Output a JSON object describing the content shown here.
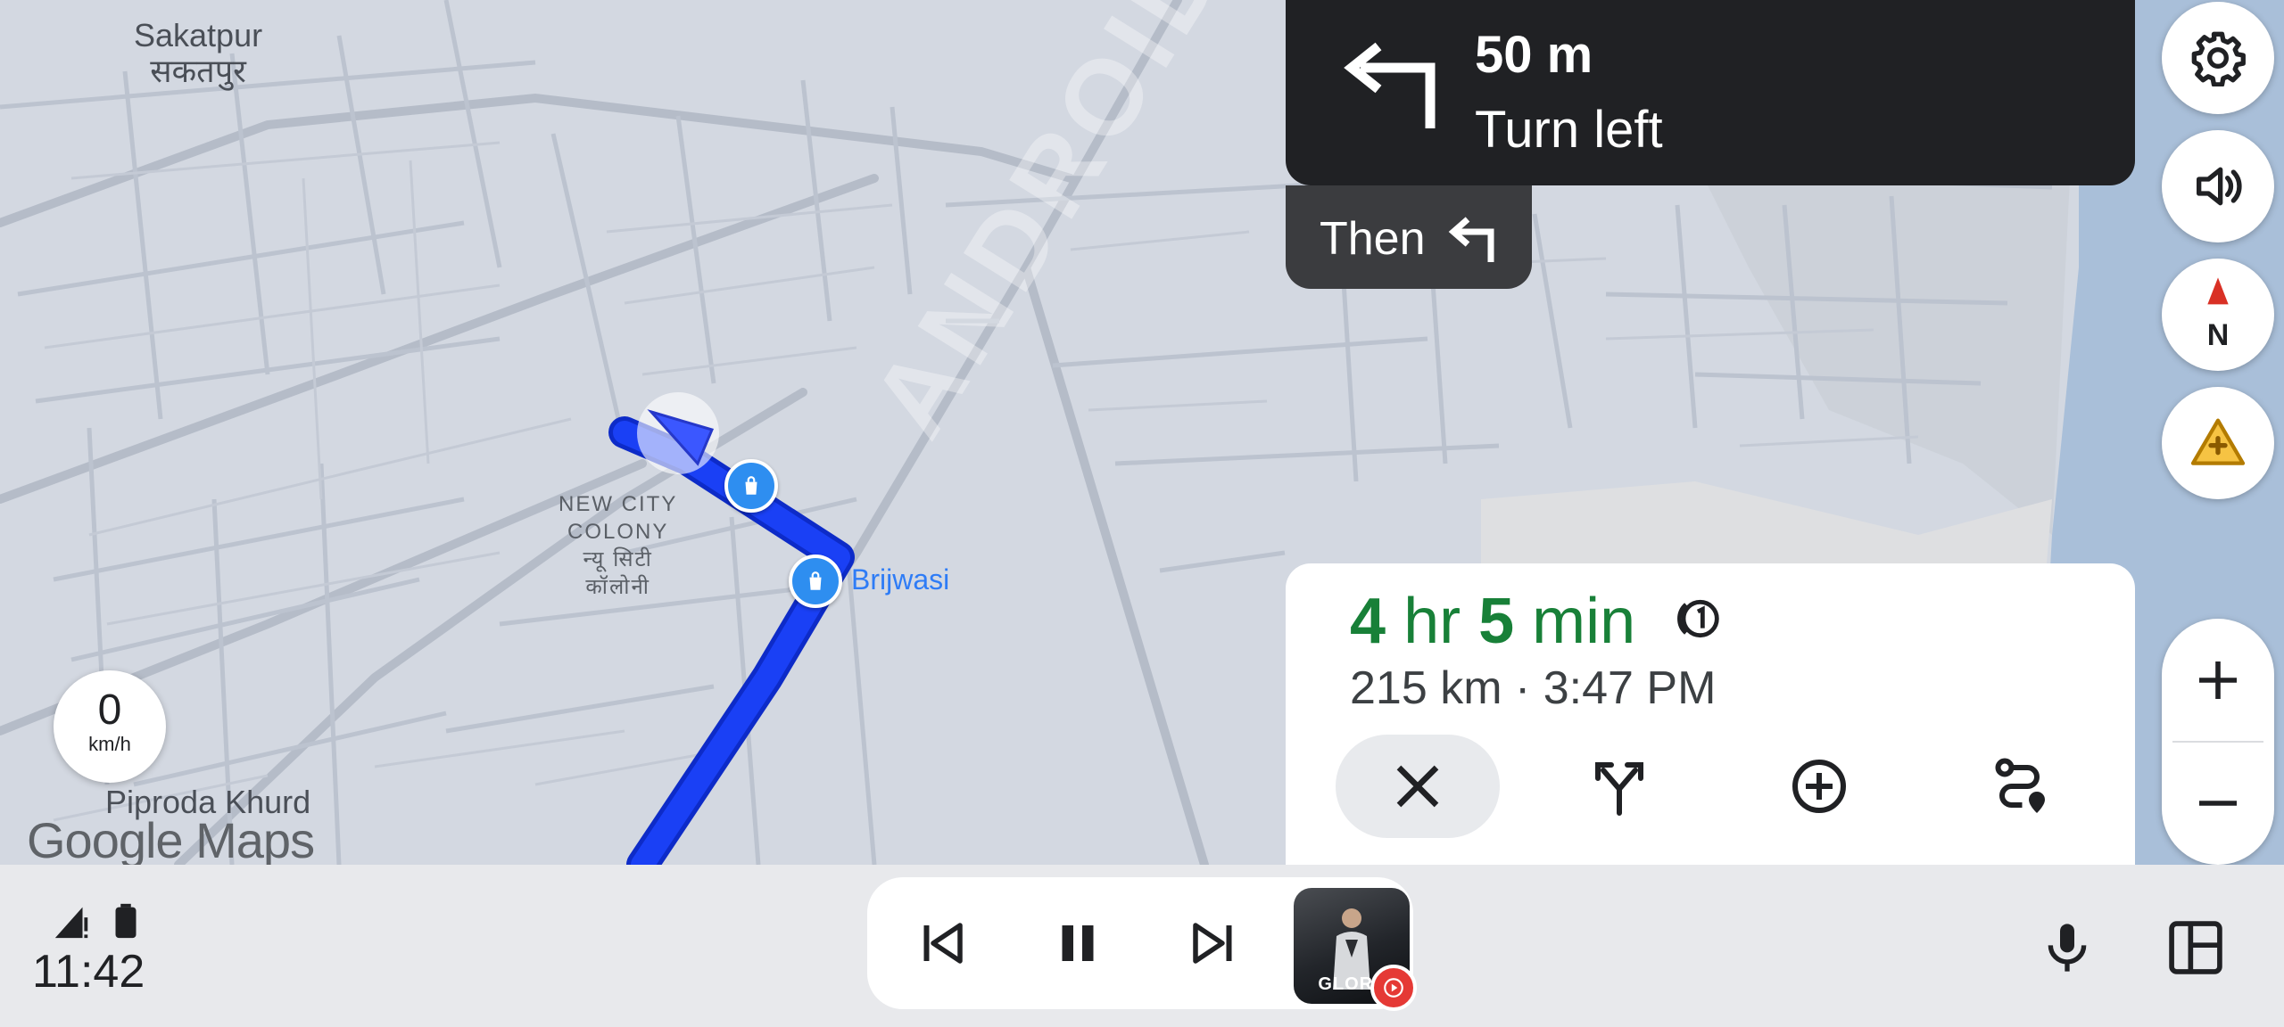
{
  "map": {
    "places": [
      {
        "name": "Sakatpur",
        "native": "सकतपुर"
      },
      {
        "name": "Piproda Khurd"
      }
    ],
    "colony": {
      "line1": "NEW CITY",
      "line2": "COLONY",
      "line3": "न्यू सिटी",
      "line4": "कॉलोनी"
    },
    "poi_label": "Brijwasi",
    "branding": "Google Maps",
    "watermark": "ANDROID AUTHORITY",
    "route_color": "#1a3cf0"
  },
  "speed": {
    "value": "0",
    "unit": "km/h"
  },
  "navigation": {
    "distance": "50 m",
    "instruction": "Turn left",
    "then_label": "Then",
    "maneuver_icon": "turn-left-icon",
    "then_icon": "turn-left-icon"
  },
  "side_buttons": [
    "settings-icon",
    "volume-icon",
    "compass-icon",
    "report-incident-icon"
  ],
  "compass": {
    "label": "N"
  },
  "zoom": {
    "in": "+",
    "out": "−"
  },
  "trip": {
    "eta_hr_value": "4",
    "eta_hr_unit": "hr",
    "eta_min_value": "5",
    "eta_min_unit": "min",
    "details": "215 km · 3:47 PM",
    "eta_color": "#188038",
    "actions": [
      "close-icon",
      "alternate-routes-icon",
      "add-stop-icon",
      "route-overview-icon"
    ]
  },
  "status": {
    "time": "11:42"
  },
  "media": {
    "album_title": "GLORY",
    "buttons": [
      "skip-previous-icon",
      "pause-icon",
      "skip-next-icon"
    ]
  }
}
